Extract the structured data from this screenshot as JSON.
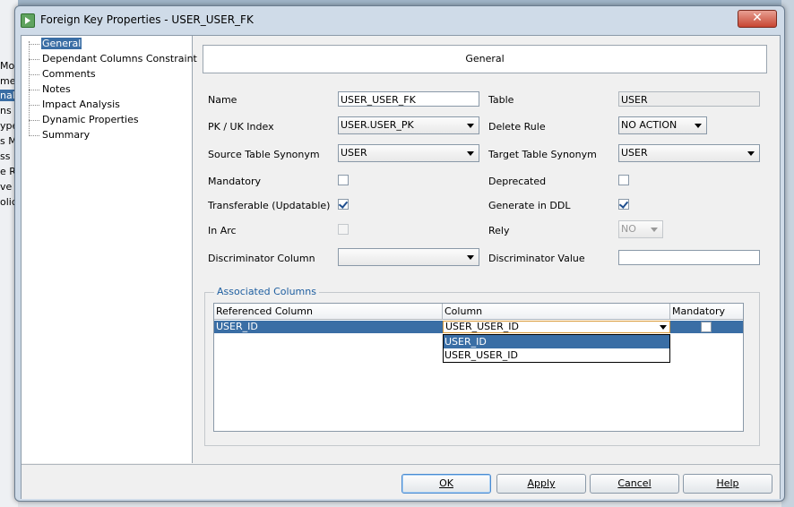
{
  "background": {
    "left_items": [
      "Mo",
      "mer",
      "nal",
      "ns [",
      "ype",
      "s M",
      "ss I",
      "e R",
      "ve T",
      "olic"
    ]
  },
  "window": {
    "title": "Foreign Key Properties - USER_USER_FK",
    "close_symbol": "✕"
  },
  "tree": {
    "items": [
      {
        "label": "General",
        "selected": true
      },
      {
        "label": "Dependant Columns Constraint"
      },
      {
        "label": "Comments"
      },
      {
        "label": "Notes"
      },
      {
        "label": "Impact Analysis"
      },
      {
        "label": "Dynamic Properties"
      },
      {
        "label": "Summary"
      }
    ]
  },
  "header": {
    "title": "General"
  },
  "form": {
    "name_label": "Name",
    "name_value": "USER_USER_FK",
    "table_label": "Table",
    "table_value": "USER",
    "pk_label": "PK / UK Index",
    "pk_value": "USER.USER_PK",
    "delete_rule_label": "Delete Rule",
    "delete_rule_value": "NO ACTION",
    "source_syn_label": "Source Table Synonym",
    "source_syn_value": "USER",
    "target_syn_label": "Target Table Synonym",
    "target_syn_value": "USER",
    "mandatory_label": "Mandatory",
    "mandatory_checked": false,
    "deprecated_label": "Deprecated",
    "deprecated_checked": false,
    "transferable_label": "Transferable (Updatable)",
    "transferable_checked": true,
    "generate_ddl_label": "Generate in DDL",
    "generate_ddl_checked": true,
    "in_arc_label": "In Arc",
    "in_arc_checked": false,
    "rely_label": "Rely",
    "rely_value": "NO",
    "disc_col_label": "Discriminator Column",
    "disc_col_value": "",
    "disc_val_label": "Discriminator Value",
    "disc_val_value": ""
  },
  "assoc": {
    "title": "Associated Columns",
    "headers": [
      "Referenced Column",
      "Column",
      "Mandatory"
    ],
    "row": {
      "referenced": "USER_ID",
      "column": "USER_USER_ID",
      "mandatory": false
    },
    "dropdown_options": [
      "USER_ID",
      "USER_USER_ID"
    ]
  },
  "buttons": {
    "ok": "OK",
    "apply": "Apply",
    "cancel": "Cancel",
    "help": "Help"
  }
}
